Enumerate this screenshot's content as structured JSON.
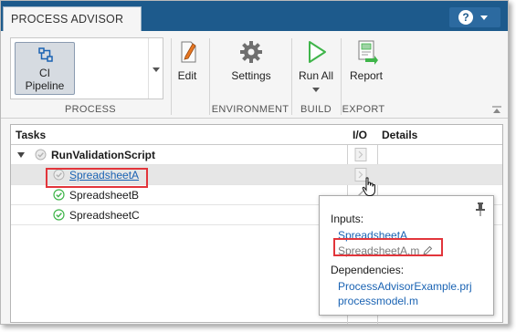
{
  "window": {
    "tab_title": "PROCESS ADVISOR",
    "help_label": "?"
  },
  "toolstrip": {
    "gallery": {
      "item_label_1": "CI",
      "item_label_2": "Pipeline"
    },
    "edit_label": "Edit",
    "settings_label": "Settings",
    "run_all_label": "Run All",
    "report_label": "Report",
    "groups": [
      "PROCESS",
      "ENVIRONMENT",
      "BUILD",
      "EXPORT"
    ]
  },
  "table": {
    "headers": {
      "tasks": "Tasks",
      "io": "I/O",
      "details": "Details"
    },
    "rows": [
      {
        "label": "RunValidationScript",
        "status": "pending",
        "level": 0
      },
      {
        "label": "SpreadsheetA",
        "status": "pending",
        "level": 1
      },
      {
        "label": "SpreadsheetB",
        "status": "passed",
        "level": 1
      },
      {
        "label": "SpreadsheetC",
        "status": "passed",
        "level": 1
      }
    ]
  },
  "io_popup": {
    "inputs_heading": "Inputs:",
    "inputs": [
      "SpreadsheetA",
      "SpreadsheetA.m"
    ],
    "dependencies_heading": "Dependencies:",
    "dependencies": [
      "ProcessAdvisorExample.prj",
      "processmodel.m"
    ]
  },
  "colors": {
    "tab_bar": "#1d5a8c",
    "link": "#1a63b3",
    "passed": "#3fb54a",
    "highlight": "#e2353b"
  }
}
